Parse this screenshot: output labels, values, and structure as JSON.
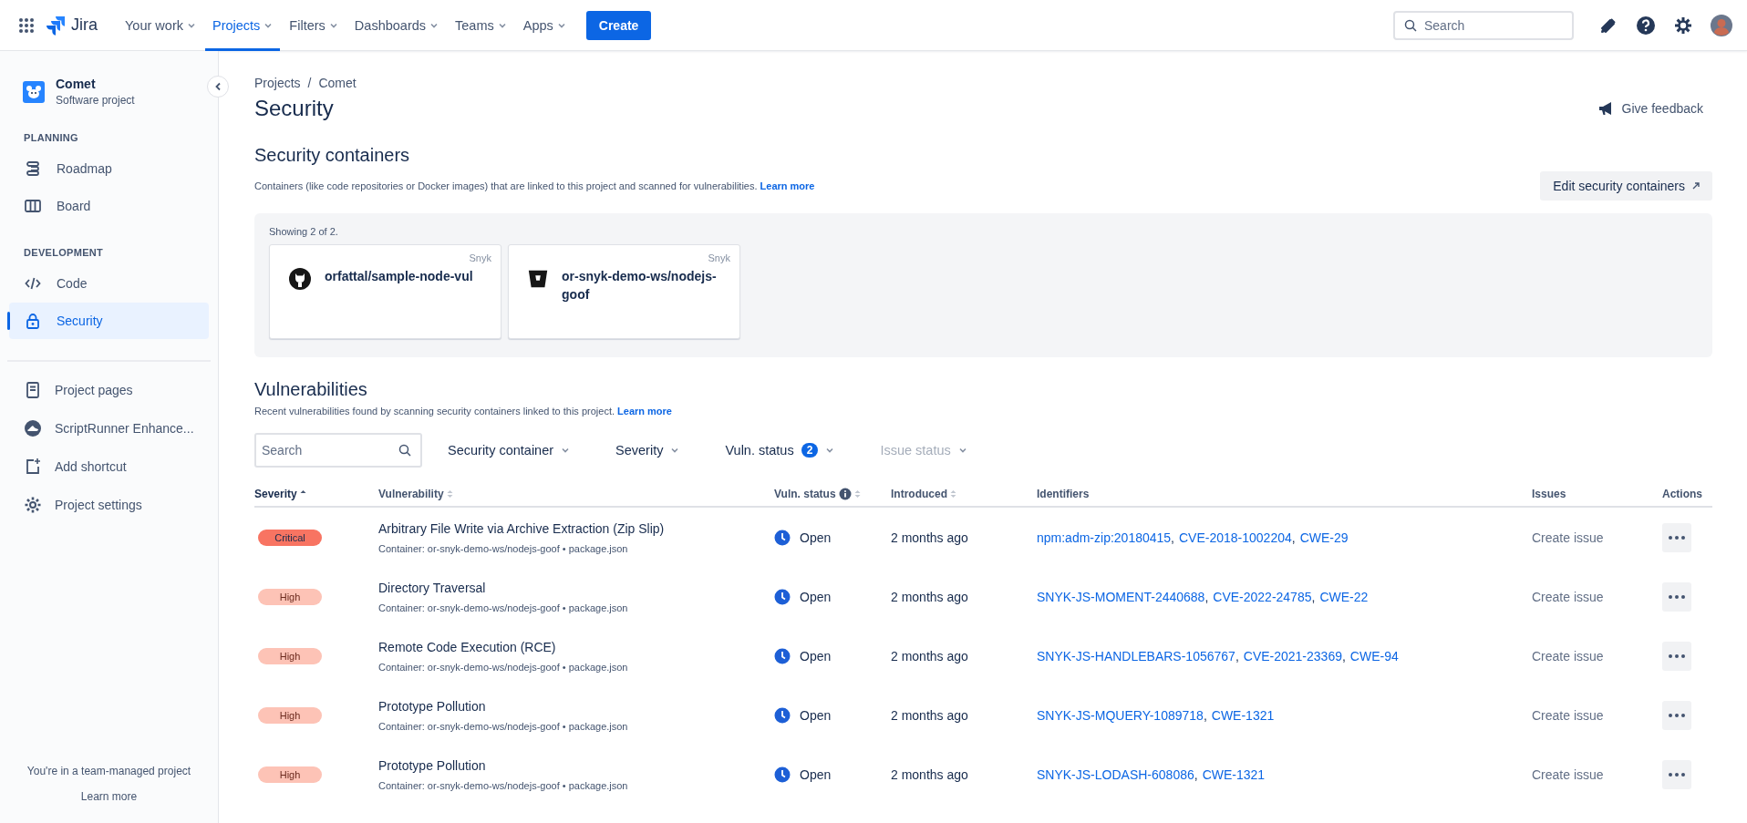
{
  "topbar": {
    "product": "Jira",
    "nav": [
      {
        "label": "Your work",
        "selected": false
      },
      {
        "label": "Projects",
        "selected": true
      },
      {
        "label": "Filters",
        "selected": false
      },
      {
        "label": "Dashboards",
        "selected": false
      },
      {
        "label": "Teams",
        "selected": false
      },
      {
        "label": "Apps",
        "selected": false
      }
    ],
    "create": "Create",
    "search": {
      "placeholder": "Search"
    }
  },
  "sidebar": {
    "project": {
      "name": "Comet",
      "type": "Software project"
    },
    "sections": [
      {
        "heading": "PLANNING",
        "items": [
          {
            "label": "Roadmap",
            "selected": false
          },
          {
            "label": "Board",
            "selected": false
          }
        ]
      },
      {
        "heading": "DEVELOPMENT",
        "items": [
          {
            "label": "Code",
            "selected": false
          },
          {
            "label": "Security",
            "selected": true
          }
        ]
      }
    ],
    "extra_items": [
      {
        "label": "Project pages"
      },
      {
        "label": "ScriptRunner Enhance..."
      },
      {
        "label": "Add shortcut"
      },
      {
        "label": "Project settings"
      }
    ],
    "footer": {
      "text": "You're in a team-managed project",
      "link": "Learn more"
    }
  },
  "page": {
    "breadcrumbs": [
      "Projects",
      "Comet"
    ],
    "separator": "/",
    "title": "Security",
    "feedback": "Give feedback"
  },
  "containers": {
    "heading": "Security containers",
    "description": "Containers (like code repositories or Docker images) that are linked to this project and scanned for vulnerabilities.",
    "link": "Learn more",
    "edit": "Edit security containers",
    "showing": "Showing 2 of 2.",
    "cards": [
      {
        "source": "Snyk",
        "name": "orfattal/sample-node-vul"
      },
      {
        "source": "Snyk",
        "name": "or-snyk-demo-ws/nodejs-goof"
      }
    ]
  },
  "vulnerabilities": {
    "heading": "Vulnerabilities",
    "description": "Recent vulnerabilities found by scanning security containers linked to this project.",
    "link": "Learn more",
    "search": {
      "placeholder": "Search"
    },
    "filters": [
      {
        "label": "Security container",
        "disabled": false
      },
      {
        "label": "Severity",
        "disabled": false
      },
      {
        "label": "Vuln. status",
        "count": "2",
        "disabled": false
      },
      {
        "label": "Issue status",
        "disabled": true
      }
    ],
    "columns": [
      {
        "label": "Severity",
        "sortable": true,
        "sorted": true,
        "info": false
      },
      {
        "label": "Vulnerability",
        "sortable": true,
        "sorted": false,
        "info": false
      },
      {
        "label": "Vuln. status",
        "sortable": true,
        "sorted": false,
        "info": true
      },
      {
        "label": "Introduced",
        "sortable": true,
        "sorted": false,
        "info": false
      },
      {
        "label": "Identifiers",
        "sortable": false,
        "sorted": false,
        "info": false
      },
      {
        "label": "Issues",
        "sortable": false,
        "sorted": false,
        "info": false
      },
      {
        "label": "Actions",
        "sortable": false,
        "sorted": false,
        "info": false
      }
    ],
    "rows": [
      {
        "severity": "Critical",
        "kind": "critical",
        "title": "Arbitrary File Write via Archive Extraction (Zip Slip)",
        "location": "Container: or-snyk-demo-ws/nodejs-goof • package.json",
        "status": "Open",
        "introduced": "2 months ago",
        "identifiers": [
          {
            "id": "npm:adm-zip:20180415",
            "sep": ","
          },
          {
            "id": "CVE-2018-1002204",
            "sep": ","
          },
          {
            "id": "CWE-29"
          }
        ],
        "issue": "Create issue"
      },
      {
        "severity": "High",
        "kind": "high",
        "title": "Directory Traversal",
        "location": "Container: or-snyk-demo-ws/nodejs-goof • package.json",
        "status": "Open",
        "introduced": "2 months ago",
        "identifiers": [
          {
            "id": "SNYK-JS-MOMENT-2440688",
            "sep": ","
          },
          {
            "id": "CVE-2022-24785",
            "sep": ","
          },
          {
            "id": "CWE-22"
          }
        ],
        "issue": "Create issue"
      },
      {
        "severity": "High",
        "kind": "high",
        "title": "Remote Code Execution (RCE)",
        "location": "Container: or-snyk-demo-ws/nodejs-goof • package.json",
        "status": "Open",
        "introduced": "2 months ago",
        "identifiers": [
          {
            "id": "SNYK-JS-HANDLEBARS-1056767",
            "sep": ","
          },
          {
            "id": "CVE-2021-23369",
            "sep": ","
          },
          {
            "id": "CWE-94"
          }
        ],
        "issue": "Create issue"
      },
      {
        "severity": "High",
        "kind": "high",
        "title": "Prototype Pollution",
        "location": "Container: or-snyk-demo-ws/nodejs-goof • package.json",
        "status": "Open",
        "introduced": "2 months ago",
        "identifiers": [
          {
            "id": "SNYK-JS-MQUERY-1089718",
            "sep": ","
          },
          {
            "id": "CWE-1321"
          }
        ],
        "issue": "Create issue"
      },
      {
        "severity": "High",
        "kind": "high",
        "title": "Prototype Pollution",
        "location": "Container: or-snyk-demo-ws/nodejs-goof • package.json",
        "status": "Open",
        "introduced": "2 months ago",
        "identifiers": [
          {
            "id": "SNYK-JS-LODASH-608086",
            "sep": ","
          },
          {
            "id": "CWE-1321"
          }
        ],
        "issue": "Create issue"
      }
    ]
  }
}
